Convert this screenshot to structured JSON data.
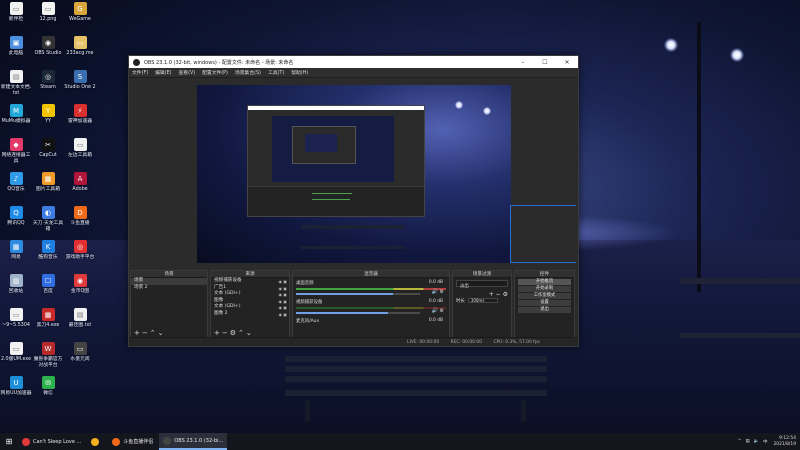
{
  "desktop": {
    "icons": [
      {
        "label": "新伴检",
        "color": "#f2f2f2",
        "glyph": "▭"
      },
      {
        "label": "12.png",
        "color": "#f2f2f2",
        "glyph": "▭"
      },
      {
        "label": "WeGame",
        "color": "#d9a53a",
        "glyph": "G"
      },
      {
        "label": "此电脑",
        "color": "#4a8fe0",
        "glyph": "▣"
      },
      {
        "label": "OBS Studio",
        "color": "#333333",
        "glyph": "◉"
      },
      {
        "label": "233acg.me",
        "color": "#e6c36a",
        "glyph": "▭"
      },
      {
        "label": "新建文本文档.txt",
        "color": "#f2f2f2",
        "glyph": "▤"
      },
      {
        "label": "Steam",
        "color": "#1b2838",
        "glyph": "◎"
      },
      {
        "label": "Studio One 2",
        "color": "#3a6fb0",
        "glyph": "S"
      },
      {
        "label": "MuMu模拟器",
        "color": "#22a7d8",
        "glyph": "M"
      },
      {
        "label": "YY",
        "color": "#f2c300",
        "glyph": "Y"
      },
      {
        "label": "雷神加速器",
        "color": "#d92f2f",
        "glyph": "⚡"
      },
      {
        "label": "网络连接器工具",
        "color": "#e23b6a",
        "glyph": "◆"
      },
      {
        "label": "CapCut",
        "color": "#111111",
        "glyph": "✂"
      },
      {
        "label": "左边工具箱",
        "color": "#f2f2f2",
        "glyph": "▭"
      },
      {
        "label": "QQ音乐",
        "color": "#2e9ae8",
        "glyph": "♪"
      },
      {
        "label": "图片工具箱",
        "color": "#f09a2a",
        "glyph": "▦"
      },
      {
        "label": "Adobe",
        "color": "#b0153a",
        "glyph": "A"
      },
      {
        "label": "腾讯QQ",
        "color": "#1f8ce8",
        "glyph": "Q"
      },
      {
        "label": "天刀·天龙工具箱",
        "color": "#3d7ce0",
        "glyph": "◐"
      },
      {
        "label": "斗鱼直播",
        "color": "#f06a1a",
        "glyph": "D"
      },
      {
        "label": "网易",
        "color": "#2f8be0",
        "glyph": "▦"
      },
      {
        "label": "酷狗音乐",
        "color": "#1f7fe0",
        "glyph": "K"
      },
      {
        "label": "游戏助手平台",
        "color": "#e23030",
        "glyph": "◎"
      },
      {
        "label": "回收站",
        "color": "#9fb3c8",
        "glyph": "▥"
      },
      {
        "label": "百度",
        "color": "#2f6de0",
        "glyph": "☐"
      },
      {
        "label": "金币Q图",
        "color": "#e03a3a",
        "glyph": "◉"
      },
      {
        "label": "~9~5.5304",
        "color": "#f2f2f2",
        "glyph": "▭"
      },
      {
        "label": "黑刀4.exe",
        "color": "#c82a2a",
        "glyph": "▦"
      },
      {
        "label": "最佳图.txt",
        "color": "#f2f2f2",
        "glyph": "▤"
      },
      {
        "label": "2.0版UM.exe",
        "color": "#f2f2f2",
        "glyph": "▭"
      },
      {
        "label": "魔兽争霸官方对战平台",
        "color": "#b82a2a",
        "glyph": "W"
      },
      {
        "label": "水墨元阅",
        "color": "#444444",
        "glyph": "▭"
      },
      {
        "label": "网易UU加速器",
        "color": "#1d8fd8",
        "glyph": "U"
      },
      {
        "label": "微信",
        "color": "#2bb24c",
        "glyph": "✉"
      }
    ]
  },
  "obs": {
    "title": "OBS 23.1.0 (32-bit, windows) - 配置文件: 未命名 - 场景: 未命名",
    "menu": [
      "文件(F)",
      "编辑(E)",
      "查看(V)",
      "配置文件(P)",
      "场景集合(S)",
      "工具(T)",
      "帮助(H)"
    ],
    "docks": {
      "scenes": {
        "title": "场景",
        "items": [
          "场景",
          "场景 2"
        ]
      },
      "sources": {
        "title": "来源",
        "items": [
          "视频捕获设备",
          "广告1",
          "文本 (GDI+)",
          "图像",
          "文本 (GDI+)",
          "图像 2"
        ]
      },
      "mixer": {
        "title": "混音器",
        "channels": [
          {
            "name": "桌面音频",
            "value": "0.0 dB",
            "level": 0.78
          },
          {
            "name": "视频捕获设备",
            "value": "0.0 dB",
            "level": 0.74
          },
          {
            "name": "麦克风/Aux",
            "value": "0.0 dB",
            "level": 0.0
          }
        ]
      },
      "transitions": {
        "title": "场景过渡",
        "selected": "淡出",
        "duration_label": "时长",
        "duration": "300ms"
      },
      "controls": {
        "title": "控件",
        "buttons": [
          "开始推流",
          "开始录制",
          "工作室模式",
          "设置",
          "退出"
        ]
      }
    },
    "status": {
      "live": "LIVE: 00:00:00",
      "rec": "REC: 00:00:00",
      "cpu": "CPU: 0.3%, 57.00 fps"
    }
  },
  "taskbar": {
    "apps": [
      {
        "label": "Can't Sleep Love ...",
        "color": "#e03a3a"
      },
      {
        "label": "",
        "color": "#f2b01e"
      },
      {
        "label": "斗鱼直播伴侣",
        "color": "#f06a1a"
      },
      {
        "label": "OBS 23.1.0 (32-bi...",
        "color": "#444444"
      }
    ],
    "time": "9:12:54",
    "date": "2021/8/19"
  }
}
